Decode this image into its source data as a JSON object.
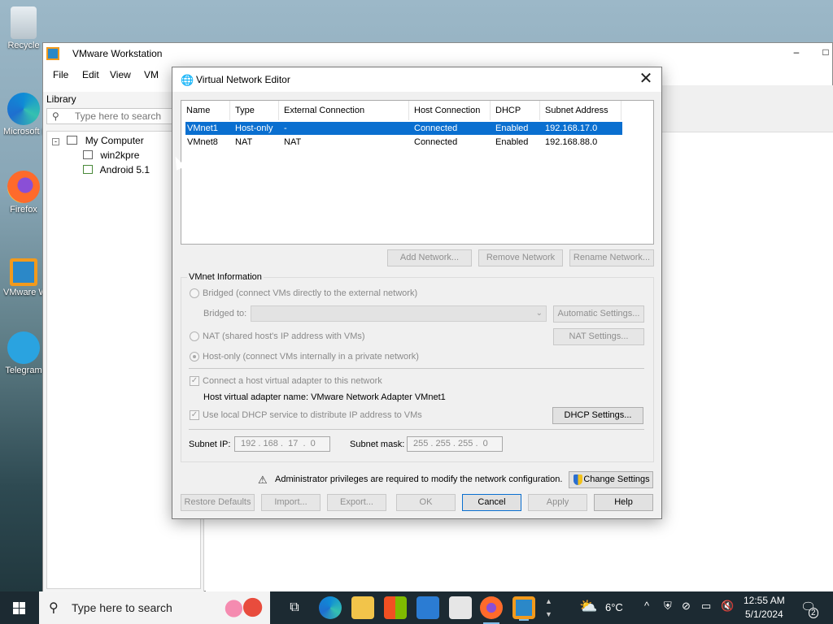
{
  "desktop": {
    "icons": [
      {
        "label": "Recycle"
      },
      {
        "label": "Microsoft Edge"
      },
      {
        "label": "Firefox"
      },
      {
        "label": "VMware Workstation"
      },
      {
        "label": "Telegram"
      }
    ]
  },
  "vmware": {
    "title": "VMware Workstation",
    "window_controls": {
      "minimize": "–",
      "maximize": "□"
    },
    "menu": [
      "File",
      "Edit",
      "View",
      "VM"
    ],
    "library": {
      "title": "Library",
      "search_placeholder": "Type here to search",
      "tree": {
        "root": "My Computer",
        "items": [
          "win2kpre",
          "Android 5.1"
        ]
      }
    }
  },
  "dialog": {
    "title": "Virtual Network Editor",
    "close_glyph": "✕",
    "table": {
      "columns": [
        "Name",
        "Type",
        "External Connection",
        "Host Connection",
        "DHCP",
        "Subnet Address"
      ],
      "rows": [
        {
          "name": "VMnet1",
          "type": "Host-only",
          "external": "-",
          "host": "Connected",
          "dhcp": "Enabled",
          "subnet": "192.168.17.0",
          "selected": true
        },
        {
          "name": "VMnet8",
          "type": "NAT",
          "external": "NAT",
          "host": "Connected",
          "dhcp": "Enabled",
          "subnet": "192.168.88.0",
          "selected": false
        }
      ]
    },
    "table_buttons": {
      "add": "Add Network...",
      "remove": "Remove Network",
      "rename": "Rename Network..."
    },
    "vmnet_info": {
      "label": "VMnet Information",
      "bridged": "Bridged (connect VMs directly to the external network)",
      "bridged_to_label": "Bridged to:",
      "automatic_settings": "Automatic Settings...",
      "nat": "NAT (shared host's IP address with VMs)",
      "nat_settings": "NAT Settings...",
      "host_only": "Host-only (connect VMs internally in a private network)",
      "connect_adapter": "Connect a host virtual adapter to this network",
      "adapter_name": "Host virtual adapter name: VMware Network Adapter VMnet1",
      "use_dhcp": "Use local DHCP service to distribute IP address to VMs",
      "dhcp_settings": "DHCP Settings...",
      "subnet_ip_label": "Subnet IP:",
      "subnet_ip": "192 . 168 .  17  .  0",
      "subnet_mask_label": "Subnet mask:",
      "subnet_mask": "255 . 255 . 255 .  0"
    },
    "admin_notice": "Administrator privileges are required to modify the network configuration.",
    "warning_glyph": "⚠",
    "change_settings": "Change Settings",
    "footer_buttons": {
      "restore": "Restore Defaults",
      "import": "Import...",
      "export": "Export...",
      "ok": "OK",
      "cancel": "Cancel",
      "apply": "Apply",
      "help": "Help"
    }
  },
  "taskbar": {
    "search_text": "Type here to search",
    "weather": "6°C",
    "time": "12:55 AM",
    "date": "5/1/2024",
    "notification_count": "2"
  }
}
